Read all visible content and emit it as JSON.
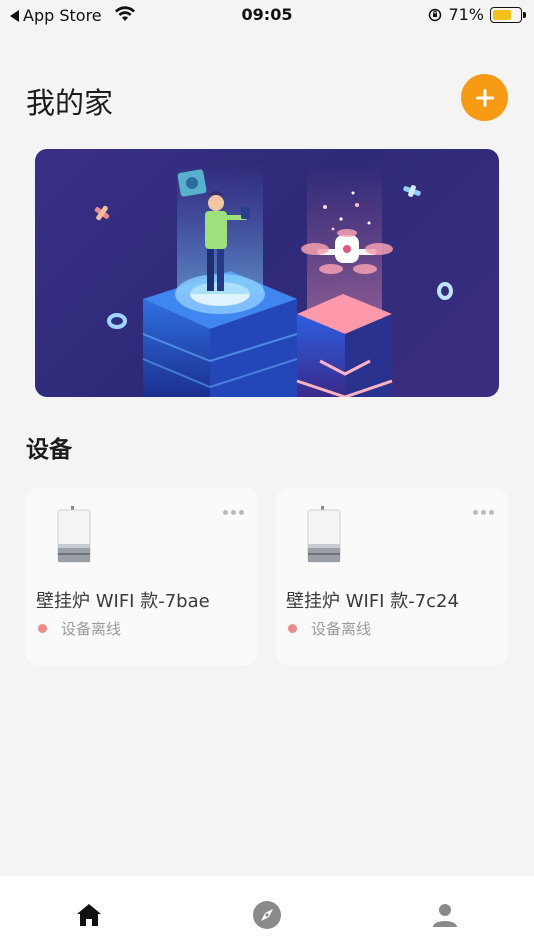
{
  "status_bar": {
    "back_app": "App Store",
    "time": "09:05",
    "battery": "71%",
    "battery_level": 0.71,
    "battery_color": "#f3c11a"
  },
  "header": {
    "title": "我的家",
    "add_icon": "plus-icon",
    "accent": "#f79a14"
  },
  "devices_section": {
    "title": "设备",
    "devices": [
      {
        "name": "壁挂炉 WIFI 款-7bae",
        "status": "设备离线",
        "status_color": "#f0898a",
        "icon": "wall-boiler-icon"
      },
      {
        "name": "壁挂炉 WIFI 款-7c24",
        "status": "设备离线",
        "status_color": "#f0898a",
        "icon": "wall-boiler-icon"
      }
    ]
  },
  "tab_bar": {
    "tabs": [
      {
        "icon": "home-icon",
        "active": true
      },
      {
        "icon": "compass-icon",
        "active": false
      },
      {
        "icon": "person-icon",
        "active": false
      }
    ]
  }
}
